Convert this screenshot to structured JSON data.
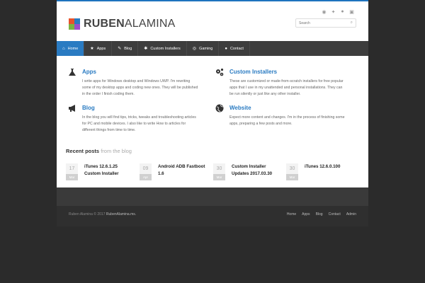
{
  "header": {
    "logo_bold": "RUBEN",
    "logo_light": "ALAMINA",
    "social_icons": [
      "rss-icon",
      "twitter-icon",
      "flickr-icon",
      "youtube-icon"
    ],
    "search_placeholder": "Search"
  },
  "nav": {
    "items": [
      {
        "label": "Home",
        "icon": "home-icon",
        "active": true
      },
      {
        "label": "Apps",
        "icon": "star-icon"
      },
      {
        "label": "Blog",
        "icon": "pencil-icon"
      },
      {
        "label": "Custom Installers",
        "icon": "gear-icon"
      },
      {
        "label": "Gaming",
        "icon": "gamepad-icon"
      },
      {
        "label": "Contact",
        "icon": "user-icon"
      }
    ]
  },
  "features": [
    {
      "title": "Apps",
      "icon": "flask-icon",
      "text": "I write apps for Windows desktop and Windows UWP. I'm rewriting some of my desktop apps and coding new ones. They will be published in the order I finish coding them."
    },
    {
      "title": "Custom Installers",
      "icon": "gears-icon",
      "text": "These are customized or made-from-scratch installers for free popular apps that I use in my unattended and personal installations. They can be run silently or just like any other installer."
    },
    {
      "title": "Blog",
      "icon": "megaphone-icon",
      "text": "In the blog you will find tips, tricks, tweaks and troubleshooting articles for PC and mobile devices. I also like to write How to articles for different things from time to time."
    },
    {
      "title": "Website",
      "icon": "globe-icon",
      "text": "Expect more content and changes. I'm in the process of finishing some apps, preparing a few posts and more."
    }
  ],
  "recent": {
    "title": "Recent posts",
    "subtitle": "from the blog",
    "posts": [
      {
        "day": "17",
        "month": "Mar",
        "title": "iTunes 12.6.1.25 Custom Installer"
      },
      {
        "day": "09",
        "month": "Apr",
        "title": "Android ADB Fastboot 1.6"
      },
      {
        "day": "30",
        "month": "Mar",
        "title": "Custom Installer Updates 2017.03.30"
      },
      {
        "day": "30",
        "month": "Mar",
        "title": "iTunes 12.6.0.100"
      }
    ]
  },
  "footer": {
    "copyright": "Ruben Alamina © 2017",
    "site": "RubenAlamina.ms.",
    "links": [
      "Home",
      "Apps",
      "Blog",
      "Contact",
      "Admin"
    ]
  },
  "colors": {
    "accent": "#2a7bc2",
    "nav_bg": "#3d3d3d",
    "page_bg": "#2b2b2b"
  }
}
